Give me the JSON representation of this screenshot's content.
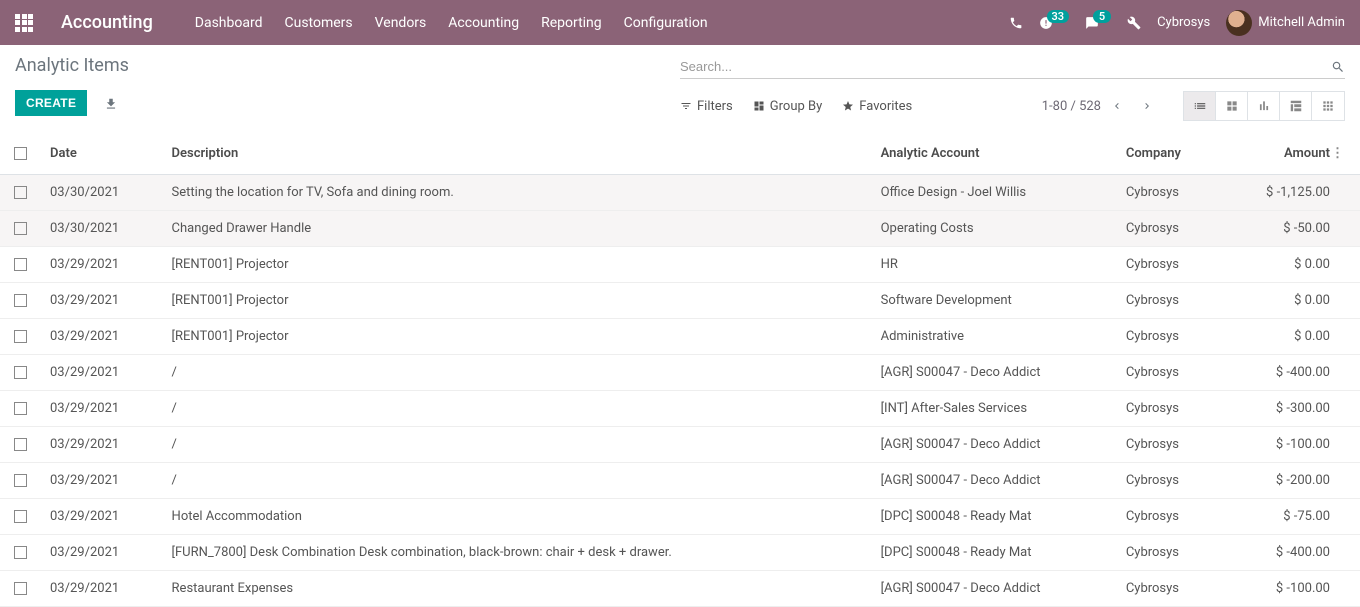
{
  "header": {
    "brand": "Accounting",
    "menu": [
      "Dashboard",
      "Customers",
      "Vendors",
      "Accounting",
      "Reporting",
      "Configuration"
    ],
    "activity_count": "33",
    "discuss_count": "5",
    "company": "Cybrosys",
    "user": "Mitchell Admin"
  },
  "page": {
    "title": "Analytic Items",
    "create": "CREATE",
    "search_placeholder": "Search...",
    "filters": "Filters",
    "groupby": "Group By",
    "favorites": "Favorites",
    "pager": "1-80 / 528"
  },
  "columns": {
    "date": "Date",
    "description": "Description",
    "analytic": "Analytic Account",
    "company": "Company",
    "amount": "Amount"
  },
  "rows": [
    {
      "date": "03/30/2021",
      "description": "Setting the location for TV, Sofa and dining room.",
      "analytic": "Office Design - Joel Willis",
      "company": "Cybrosys",
      "amount": "$ -1,125.00"
    },
    {
      "date": "03/30/2021",
      "description": "Changed Drawer Handle",
      "analytic": "Operating Costs",
      "company": "Cybrosys",
      "amount": "$ -50.00"
    },
    {
      "date": "03/29/2021",
      "description": "[RENT001] Projector",
      "analytic": "HR",
      "company": "Cybrosys",
      "amount": "$ 0.00"
    },
    {
      "date": "03/29/2021",
      "description": "[RENT001] Projector",
      "analytic": "Software Development",
      "company": "Cybrosys",
      "amount": "$ 0.00"
    },
    {
      "date": "03/29/2021",
      "description": "[RENT001] Projector",
      "analytic": "Administrative",
      "company": "Cybrosys",
      "amount": "$ 0.00"
    },
    {
      "date": "03/29/2021",
      "description": "/",
      "analytic": "[AGR] S00047 - Deco Addict",
      "company": "Cybrosys",
      "amount": "$ -400.00"
    },
    {
      "date": "03/29/2021",
      "description": "/",
      "analytic": "[INT] After-Sales Services",
      "company": "Cybrosys",
      "amount": "$ -300.00"
    },
    {
      "date": "03/29/2021",
      "description": "/",
      "analytic": "[AGR] S00047 - Deco Addict",
      "company": "Cybrosys",
      "amount": "$ -100.00"
    },
    {
      "date": "03/29/2021",
      "description": "/",
      "analytic": "[AGR] S00047 - Deco Addict",
      "company": "Cybrosys",
      "amount": "$ -200.00"
    },
    {
      "date": "03/29/2021",
      "description": "Hotel Accommodation",
      "analytic": "[DPC] S00048 - Ready Mat",
      "company": "Cybrosys",
      "amount": "$ -75.00"
    },
    {
      "date": "03/29/2021",
      "description": "[FURN_7800] Desk Combination Desk combination, black-brown: chair + desk + drawer.",
      "analytic": "[DPC] S00048 - Ready Mat",
      "company": "Cybrosys",
      "amount": "$ -400.00"
    },
    {
      "date": "03/29/2021",
      "description": "Restaurant Expenses",
      "analytic": "[AGR] S00047 - Deco Addict",
      "company": "Cybrosys",
      "amount": "$ -100.00"
    }
  ]
}
